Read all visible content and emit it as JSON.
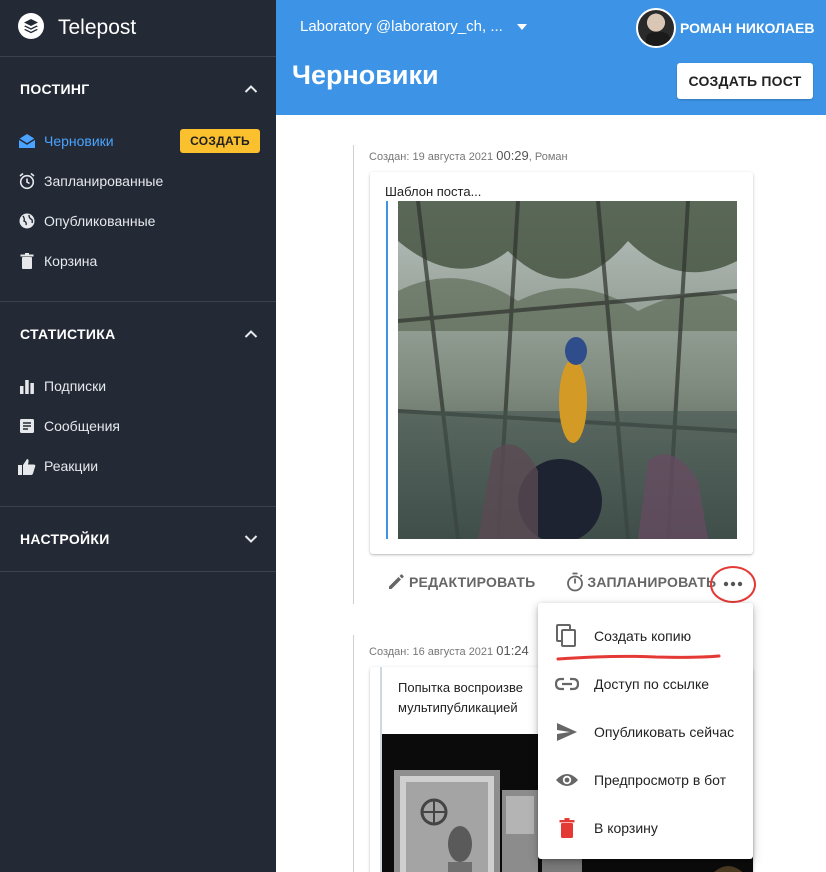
{
  "brand": {
    "name": "Telepost"
  },
  "sidebar": {
    "posting": {
      "title": "ПОСТИНГ",
      "items": [
        {
          "label": "Черновики",
          "icon": "drafts-icon",
          "badge": "СОЗДАТЬ"
        },
        {
          "label": "Запланированные",
          "icon": "alarm-icon"
        },
        {
          "label": "Опубликованные",
          "icon": "globe-icon"
        },
        {
          "label": "Корзина",
          "icon": "trash-icon"
        }
      ]
    },
    "stats": {
      "title": "СТАТИСТИКА",
      "items": [
        {
          "label": "Подписки",
          "icon": "bar-chart-icon"
        },
        {
          "label": "Сообщения",
          "icon": "message-icon"
        },
        {
          "label": "Реакции",
          "icon": "thumb-up-icon"
        }
      ]
    },
    "settings": {
      "title": "НАСТРОЙКИ"
    }
  },
  "header": {
    "channel": "Laboratory @laboratory_ch, ...",
    "user_name": "РОМАН НИКОЛАЕВ",
    "page_title": "Черновики",
    "create_post": "СОЗДАТЬ ПОСТ"
  },
  "posts": [
    {
      "meta_prefix": "Создан: 19 августа 2021",
      "meta_time": "00:29",
      "meta_suffix": ", Роман",
      "text": "Шаблон поста...",
      "actions": {
        "edit": "РЕДАКТИРОВАТЬ",
        "schedule": "ЗАПЛАНИРОВАТЬ"
      }
    },
    {
      "meta_prefix": "Создан: 16 августа 2021",
      "meta_time": "01:24",
      "text_line1": "Попытка воспроизве",
      "text_line2": "мультипубликацией"
    }
  ],
  "menu": {
    "items": [
      {
        "label": "Создать копию",
        "icon": "copy-icon"
      },
      {
        "label": "Доступ по ссылке",
        "icon": "link-icon"
      },
      {
        "label": "Опубликовать сейчас",
        "icon": "send-icon"
      },
      {
        "label": "Предпросмотр в бот",
        "icon": "eye-icon"
      },
      {
        "label": "В корзину",
        "icon": "trash-icon"
      }
    ]
  },
  "colors": {
    "accent": "#3d94e6",
    "sidebar_bg": "#232a35",
    "badge": "#fbc02d",
    "annotation_red": "#e53935"
  }
}
